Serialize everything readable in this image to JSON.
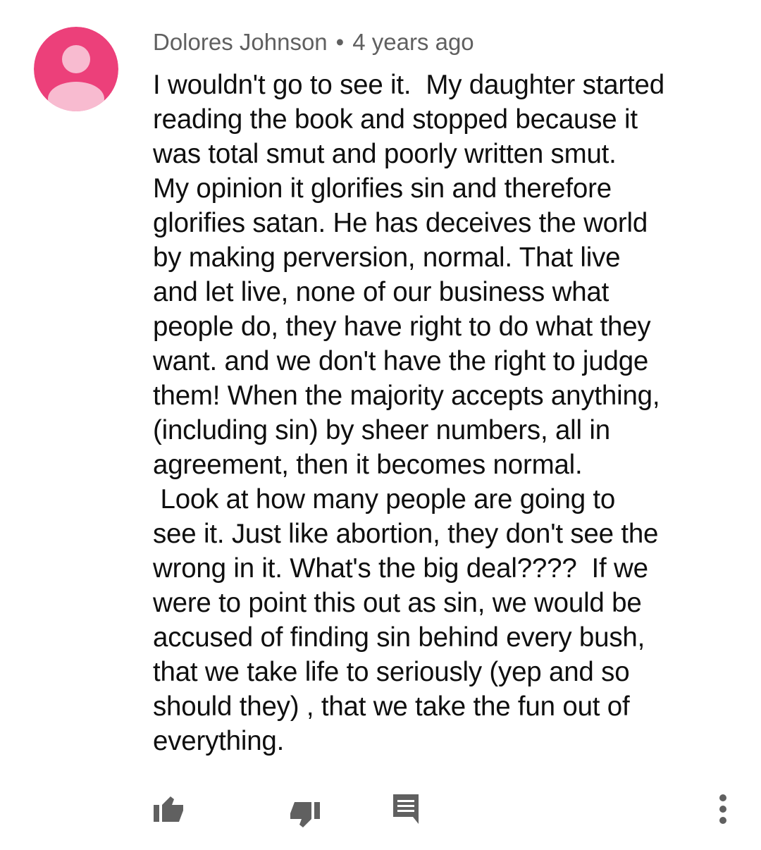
{
  "comment": {
    "author": "Dolores Johnson",
    "separator": "•",
    "timestamp": "4 years ago",
    "lines": [
      "I wouldn't go to see it.  My daughter started",
      "reading the book and stopped because it",
      "was total smut and poorly written smut.",
      "My opinion it glorifies sin and therefore",
      "glorifies satan. He has deceives the world",
      "by making perversion, normal. That live",
      "and let live, none of our business what",
      "people do, they have right to do what they",
      "want. and we don't have the right to judge",
      "them! When the majority accepts anything,",
      "(including sin) by sheer numbers, all in",
      "agreement, then it becomes normal.",
      " Look at how many people are going to",
      "see it. Just like abortion, they don't see the",
      "wrong in it. What's the big deal????  If we",
      "were to point this out as sin, we would be",
      "accused of finding sin behind every bush,",
      "that we take life to seriously (yep and so",
      "should they) , that we take the fun out of",
      "everything."
    ]
  },
  "avatar": {
    "background_color": "#ec407a",
    "figure_color": "#f8bbd0"
  },
  "actions": {
    "like_icon": "thumbs-up-icon",
    "dislike_icon": "thumbs-down-icon",
    "reply_icon": "comment-icon",
    "more_icon": "more-vertical-icon",
    "icon_color": "#606060"
  }
}
